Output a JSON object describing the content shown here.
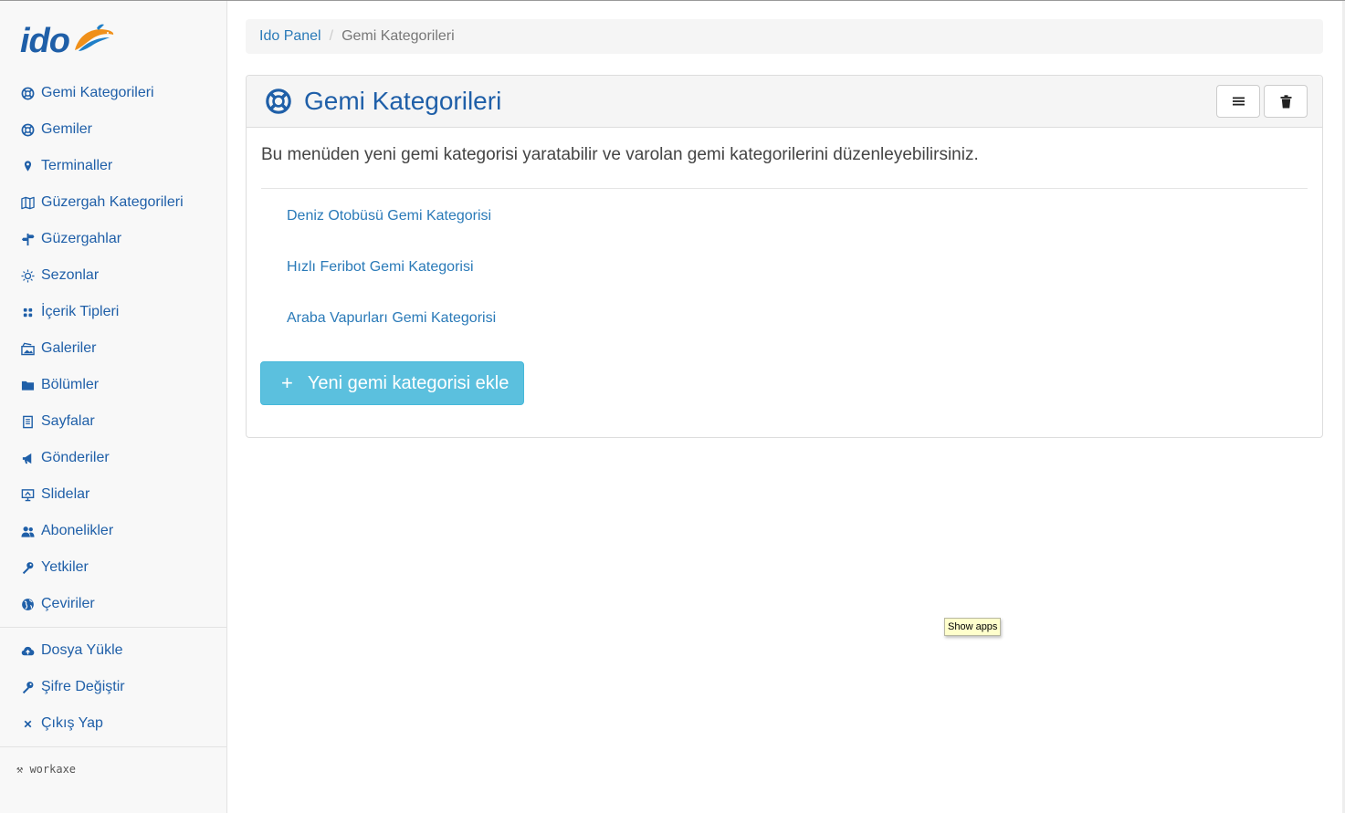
{
  "logo": {
    "text": "ido",
    "icon": "dolphin-logo-icon",
    "colors": {
      "text": "#1f5fa8",
      "dolphin_orange": "#f0901a",
      "dolphin_blue": "#1f7fc8"
    }
  },
  "sidebar": {
    "items": [
      {
        "label": "Gemi Kategorileri",
        "icon": "lifebuoy-icon"
      },
      {
        "label": "Gemiler",
        "icon": "lifebuoy-icon"
      },
      {
        "label": "Terminaller",
        "icon": "map-pin-icon"
      },
      {
        "label": "Güzergah Kategorileri",
        "icon": "map-icon"
      },
      {
        "label": "Güzergahlar",
        "icon": "signpost-icon"
      },
      {
        "label": "Sezonlar",
        "icon": "sun-icon"
      },
      {
        "label": "İçerik Tipleri",
        "icon": "grid-icon"
      },
      {
        "label": "Galeriler",
        "icon": "gallery-icon"
      },
      {
        "label": "Bölümler",
        "icon": "folder-icon"
      },
      {
        "label": "Sayfalar",
        "icon": "document-icon"
      },
      {
        "label": "Gönderiler",
        "icon": "megaphone-icon"
      },
      {
        "label": "Slidelar",
        "icon": "presentation-icon"
      },
      {
        "label": "Abonelikler",
        "icon": "users-icon"
      },
      {
        "label": "Yetkiler",
        "icon": "key-icon"
      },
      {
        "label": "Çeviriler",
        "icon": "globe-icon"
      }
    ],
    "bottom_items": [
      {
        "label": "Dosya Yükle",
        "icon": "cloud-upload-icon"
      },
      {
        "label": "Şifre Değiştir",
        "icon": "key-icon"
      },
      {
        "label": "Çıkış Yap",
        "icon": "close-icon"
      }
    ],
    "footer": "⚒ workaxe"
  },
  "breadcrumb": {
    "home": "Ido Panel",
    "separator": "/",
    "current": "Gemi Kategorileri"
  },
  "panel": {
    "title": "Gemi Kategorileri",
    "title_icon": "lifebuoy-icon",
    "description": "Bu menüden yeni gemi kategorisi yaratabilir ve varolan gemi kategorilerini düzenleyebilirsiniz.",
    "categories": [
      "Deniz Otobüsü Gemi Kategorisi",
      "Hızlı Feribot Gemi Kategorisi",
      "Araba Vapurları Gemi Kategorisi"
    ],
    "add_button": {
      "icon": "+",
      "label": "Yeni gemi kategorisi ekle"
    },
    "heading_buttons": [
      "list-icon",
      "trash-icon"
    ]
  },
  "tooltip": "Show apps",
  "colors": {
    "accent": "#1f5fa8",
    "link": "#2a7ab8",
    "info_button": "#5bc0de"
  }
}
